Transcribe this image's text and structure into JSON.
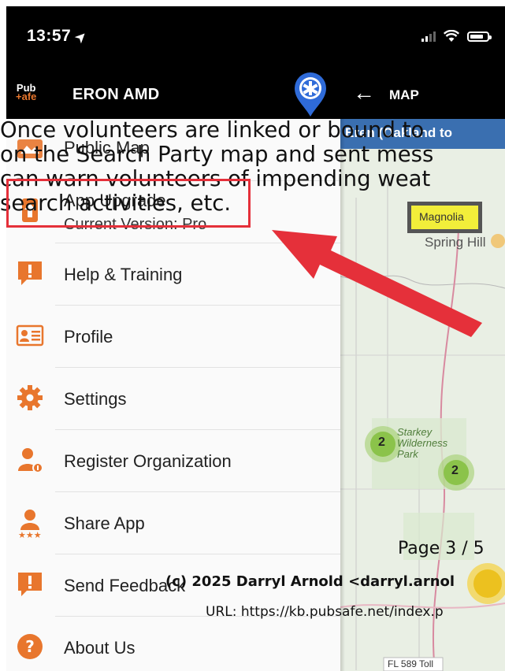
{
  "status": {
    "time": "13:57"
  },
  "appbar": {
    "brand": "ERON AMD",
    "logo_line1": "Pub",
    "logo_line2": "+afe",
    "map_label": "MAP"
  },
  "map": {
    "banner": "Eren (Oakland to",
    "spring_hill": "Spring Hill",
    "tag": "Magnolia",
    "park_label": "Starkey Wilderness Park",
    "park_l1": "Starkey",
    "park_l2": "Wilderness",
    "park_l3": "Park",
    "cluster_a": "2",
    "cluster_b": "2",
    "road": "FL 589 Toll"
  },
  "drawer": {
    "items": [
      {
        "label": "Public Map",
        "icon": "map-icon"
      },
      {
        "label": "App Upgrade",
        "sublabel": "Current Version: Pro",
        "icon": "upgrade-icon"
      },
      {
        "label": "Help & Training",
        "icon": "help-icon"
      },
      {
        "label": "Profile",
        "icon": "profile-card-icon"
      },
      {
        "label": "Settings",
        "icon": "gear-icon"
      },
      {
        "label": "Register Organization",
        "icon": "register-org-icon"
      },
      {
        "label": "Share App",
        "icon": "share-app-icon"
      },
      {
        "label": "Send Feedback",
        "icon": "feedback-icon"
      },
      {
        "label": "About Us",
        "icon": "question-icon"
      }
    ]
  },
  "overlay_text": {
    "line1": "Once volunteers are linked or bound to",
    "line2": "on the Search Party map and sent mess",
    "line3": "can warn volunteers of impending weat",
    "line4": "search activities, etc."
  },
  "footer": {
    "page": "Page 3 / 5",
    "copyright": "(c) 2025 Darryl Arnold <darryl.arnol",
    "url": "URL: https://kb.pubsafe.net/index.p"
  },
  "colors": {
    "accent": "#e8762d",
    "highlight": "#e5303a",
    "map_cluster": "#8bc34a",
    "pin_blue": "#2f6bd8"
  }
}
